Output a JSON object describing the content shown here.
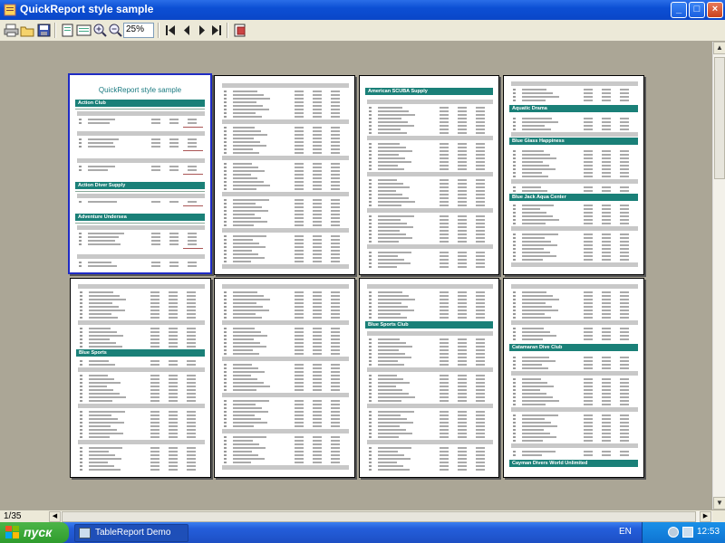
{
  "window": {
    "title": "QuickReport style sample",
    "minimize": "_",
    "maximize": "□",
    "close": "×"
  },
  "toolbar": {
    "zoom_value": "25%",
    "icons": [
      "print-icon",
      "open-icon",
      "save-icon",
      "whole-page-icon",
      "page-width-icon",
      "zoom-in-icon",
      "zoom-out-icon",
      "first-page-icon",
      "prev-page-icon",
      "next-page-icon",
      "last-page-icon",
      "close-preview-icon"
    ]
  },
  "status": {
    "page_indicator": "1/35"
  },
  "pages": [
    {
      "title": "QuickReport style sample",
      "sections": [
        {
          "name": "Action Club",
          "rows": 7
        },
        {
          "name": "Action Diver Supply",
          "rows": 3
        },
        {
          "name": "Adventure Undersea",
          "rows": 8
        }
      ]
    },
    {
      "title": "",
      "sections": []
    },
    {
      "title": "",
      "sections": [
        {
          "name": "American SCUBA Supply",
          "rows": 30
        }
      ]
    },
    {
      "title": "",
      "sections": [
        {
          "name": "Aquatic Drama",
          "rows": 2
        },
        {
          "name": "Blue Glass Happiness",
          "rows": 6
        },
        {
          "name": "Blue Jack Aqua Center",
          "rows": 6
        }
      ]
    },
    {
      "title": "",
      "sections": [
        {
          "name": "Blue Sports",
          "rows": 6
        }
      ]
    },
    {
      "title": "",
      "sections": []
    },
    {
      "title": "",
      "sections": [
        {
          "name": "Blue Sports Club",
          "rows": 16
        }
      ]
    },
    {
      "title": "",
      "sections": [
        {
          "name": "Catamaran Dive Club",
          "rows": 14
        },
        {
          "name": "Cayman Divers World Unlimited",
          "rows": 0
        }
      ]
    }
  ],
  "taskbar": {
    "start_label": "пуск",
    "task_label": "TableReport Demo",
    "lang": "EN",
    "clock": "12:53"
  },
  "colors": {
    "accent_teal": "#1a8078",
    "selected_page_border": "#1f2bc4",
    "preview_background": "#aba696"
  }
}
